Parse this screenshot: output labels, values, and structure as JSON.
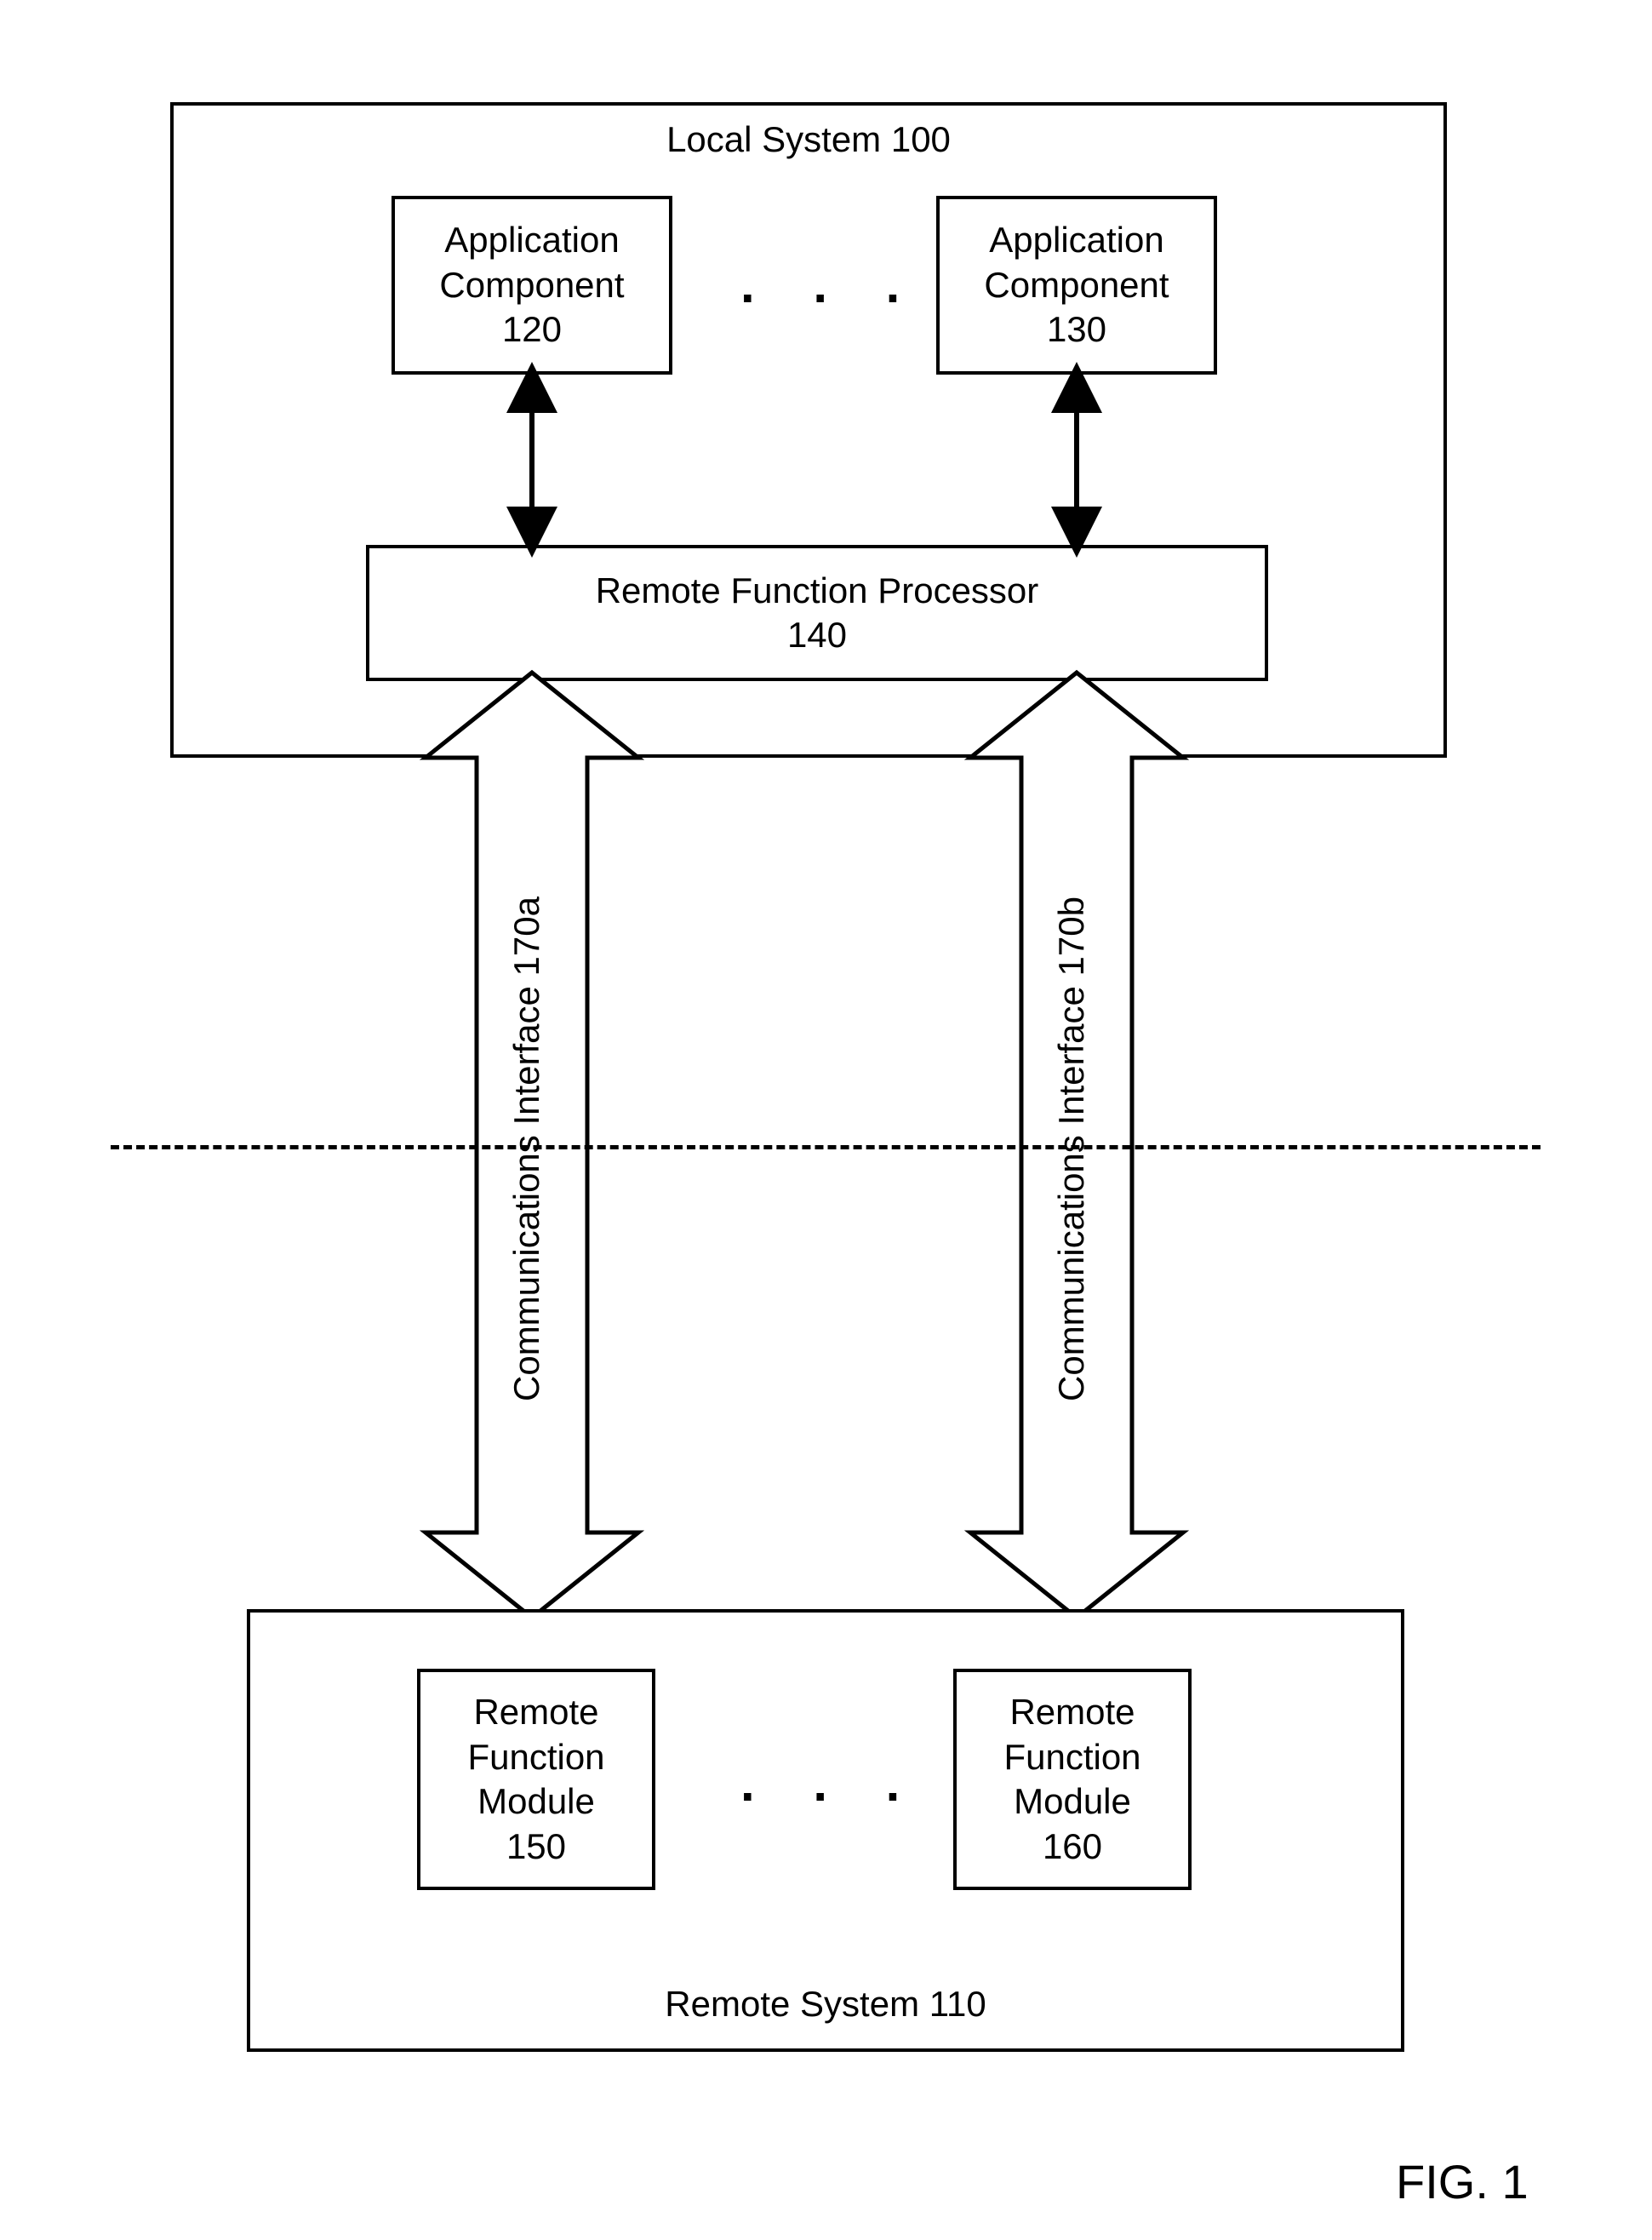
{
  "figureLabel": "FIG. 1",
  "localSystem": {
    "title": "Local System 100",
    "appComp1": {
      "line1": "Application",
      "line2": "Component",
      "line3": "120"
    },
    "appComp2": {
      "line1": "Application",
      "line2": "Component",
      "line3": "130"
    },
    "rfp": {
      "line1": "Remote Function Processor",
      "line2": "140"
    },
    "ellipsis": ". . ."
  },
  "remoteSystem": {
    "title": "Remote System 110",
    "rfm1": {
      "line1": "Remote",
      "line2": "Function",
      "line3": "Module",
      "line4": "150"
    },
    "rfm2": {
      "line1": "Remote",
      "line2": "Function",
      "line3": "Module",
      "line4": "160"
    },
    "ellipsis": ". . ."
  },
  "commInterfaceA": "Communications Interface 170a",
  "commInterfaceB": "Communications Interface 170b"
}
